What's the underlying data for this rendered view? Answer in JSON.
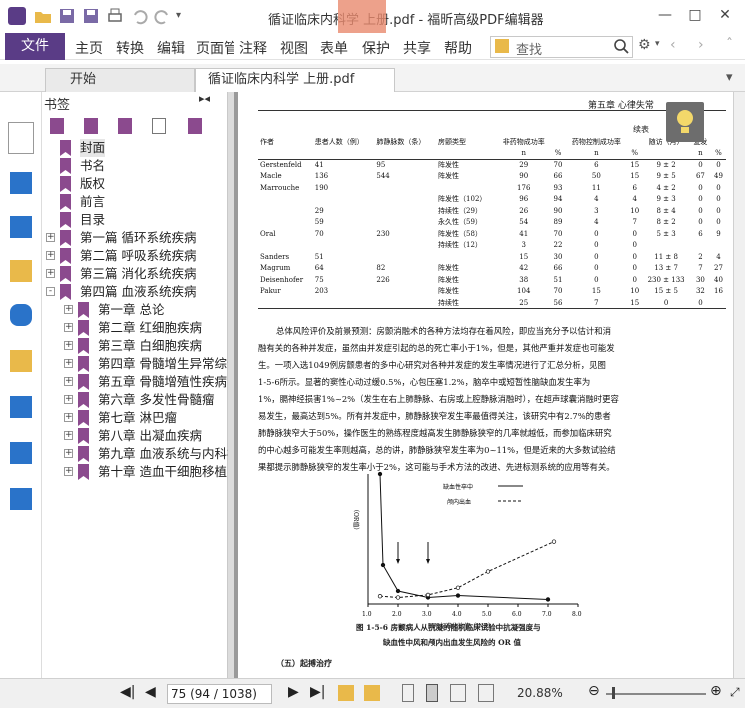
{
  "title": "循证临床内科学 上册.pdf - 福昕高级PDF编辑器",
  "menu": {
    "file": "文件",
    "items": [
      "主页",
      "转换",
      "编辑",
      "页面管理",
      "注释",
      "视图",
      "表单",
      "保护",
      "共享",
      "帮助"
    ]
  },
  "search": {
    "placeholder": "查找"
  },
  "tabs": [
    {
      "label": "开始"
    },
    {
      "label": "循证临床内科学 上册.pdf"
    }
  ],
  "bookmarks": {
    "header": "书签",
    "items": [
      {
        "label": "封面",
        "level": 0,
        "expander": ""
      },
      {
        "label": "书名",
        "level": 0,
        "expander": ""
      },
      {
        "label": "版权",
        "level": 0,
        "expander": ""
      },
      {
        "label": "前言",
        "level": 0,
        "expander": ""
      },
      {
        "label": "目录",
        "level": 0,
        "expander": ""
      },
      {
        "label": "第一篇 循环系统疾病",
        "level": 0,
        "expander": "+"
      },
      {
        "label": "第二篇 呼吸系统疾病",
        "level": 0,
        "expander": "+"
      },
      {
        "label": "第三篇 消化系统疾病",
        "level": 0,
        "expander": "+"
      },
      {
        "label": "第四篇 血液系统疾病",
        "level": 0,
        "expander": "-"
      },
      {
        "label": "第一章 总论",
        "level": 1,
        "expander": "+"
      },
      {
        "label": "第二章 红细胞疾病",
        "level": 1,
        "expander": "+"
      },
      {
        "label": "第三章 白细胞疾病",
        "level": 1,
        "expander": "+"
      },
      {
        "label": "第四章 骨髓增生异常综合征",
        "level": 1,
        "expander": "+"
      },
      {
        "label": "第五章 骨髓增殖性疾病",
        "level": 1,
        "expander": "+"
      },
      {
        "label": "第六章 多发性骨髓瘤",
        "level": 1,
        "expander": "+"
      },
      {
        "label": "第七章 淋巴瘤",
        "level": 1,
        "expander": "+"
      },
      {
        "label": "第八章 出凝血疾病",
        "level": 1,
        "expander": "+"
      },
      {
        "label": "第九章 血液系统与内科疾病",
        "level": 1,
        "expander": "+"
      },
      {
        "label": "第十章 造血干细胞移植",
        "level": 1,
        "expander": "+"
      }
    ]
  },
  "page": {
    "running_head": "第五章 心律失常",
    "table_cont": "续表",
    "headers": [
      "作者",
      "患者人数（例）",
      "肺静脉数（条）",
      "房颤类型",
      "非药物成功率",
      "",
      "药物控制成功率",
      "",
      "随访（月）",
      "复发",
      ""
    ],
    "subheaders": [
      "",
      "",
      "",
      "",
      "n",
      "%",
      "n",
      "%",
      "",
      "n",
      "%"
    ],
    "rows": [
      [
        "Gerstenfeld",
        "41",
        "95",
        "阵发性",
        "29",
        "70",
        "6",
        "15",
        "9 ± 2",
        "0",
        "0"
      ],
      [
        "Macle",
        "136",
        "544",
        "阵发性",
        "90",
        "66",
        "50",
        "15",
        "9 ± 5",
        "67",
        "49"
      ],
      [
        "Marrouche",
        "190",
        "",
        "",
        "176",
        "93",
        "11",
        "6",
        "4 ± 2",
        "0",
        "0"
      ],
      [
        "",
        "",
        "",
        "阵发性（102）",
        "96",
        "94",
        "4",
        "4",
        "9 ± 3",
        "0",
        "0"
      ],
      [
        "",
        "29",
        "",
        "持续性（29）",
        "26",
        "90",
        "3",
        "10",
        "8 ± 4",
        "0",
        "0"
      ],
      [
        "",
        "59",
        "",
        "永久性（59）",
        "54",
        "89",
        "4",
        "7",
        "8 ± 2",
        "0",
        "0"
      ],
      [
        "Oral",
        "70",
        "230",
        "阵发性（58）",
        "41",
        "70",
        "0",
        "0",
        "5 ± 3",
        "6",
        "9"
      ],
      [
        "",
        "",
        "",
        "持续性（12）",
        "3",
        "22",
        "0",
        "0",
        "",
        "",
        ""
      ],
      [
        "Sanders",
        "51",
        "",
        "",
        "15",
        "30",
        "0",
        "0",
        "11 ± 8",
        "2",
        "4"
      ],
      [
        "Magrum",
        "64",
        "82",
        "阵发性",
        "42",
        "66",
        "0",
        "0",
        "13 ± 7",
        "7",
        "27"
      ],
      [
        "Deisenhofer",
        "75",
        "226",
        "阵发性",
        "38",
        "51",
        "0",
        "0",
        "230 ± 133",
        "30",
        "40"
      ],
      [
        "Pakur",
        "203",
        "",
        "阵发性",
        "104",
        "70",
        "15",
        "10",
        "15 ± 5",
        "32",
        "16"
      ],
      [
        "",
        "",
        "",
        "持续性",
        "25",
        "56",
        "7",
        "15",
        "0",
        "0",
        ""
      ]
    ],
    "paragraph": [
      "总体风险评价及前景预测：房颤消融术的各种方法均存在着风险，即应当充分予以估计和消",
      "融有关的各种并发症，虽然由并发症引起的总的死亡率小于1%，但是，其他严重并发症也可能发",
      "生。一项入选1049例房颤患者的多中心研究对各种并发症的发生率情况进行了汇总分析，见图",
      "1-5-6所示。显著的窦性心动过缓0.5%，心包压塞1.2%，脑卒中或短暂性脑缺血发生率为",
      "1%，膈神经损害1%~2%（发生在右上肺静脉、右房或上腔静脉消融时），在超声球囊消融时更容",
      "易发生，最高达到5%。所有并发症中，肺静脉狭窄发生率最值得关注，该研究中有2.7%的患者",
      "肺静脉狭窄大于50%，操作医生的熟练程度越高发生肺静脉狭窄的几率就越低，而参加临床研究",
      "的中心越多可能发生率则越高，总的讲，肺静脉狭窄发生率为0~11%，但是近来的大多数试验结",
      "果都提示肺静脉狭窄的发生率小于2%，这可能与手术方法的改进、先进标测系统的应用等有关。"
    ],
    "figure_caption_1": "图 1-5-6  房颤病人从抗凝的随机临床试验中抗凝强度与",
    "figure_caption_2": "缺血性中风和颅内出血发生风险的 OR 值",
    "section": "（五）起搏治疗",
    "legend_1": "缺血性卒中",
    "legend_2": "颅内出血",
    "ylabel": "（OR值）",
    "xlabel": "国际标准化比值（INR）"
  },
  "chart_data": {
    "type": "line",
    "xlabel": "国际标准化比值（INR）",
    "ylabel": "（OR值）",
    "xlim": [
      1.0,
      8.0
    ],
    "ylim": [
      0,
      20
    ],
    "xticks": [
      "1.0",
      "2.0",
      "3.0",
      "4.0",
      "5.0",
      "6.0",
      "7.0",
      "8.0"
    ],
    "yticks": [
      "20",
      "15",
      "10",
      "5"
    ],
    "series": [
      {
        "name": "缺血性卒中",
        "style": "solid",
        "points": [
          [
            1.4,
            20
          ],
          [
            1.5,
            6
          ],
          [
            2.0,
            2
          ],
          [
            3.0,
            1
          ],
          [
            4.0,
            1.3
          ],
          [
            7.0,
            0.7
          ]
        ]
      },
      {
        "name": "颅内出血",
        "style": "dashed",
        "points": [
          [
            1.4,
            1.2
          ],
          [
            2.0,
            1
          ],
          [
            3.0,
            1.4
          ],
          [
            4.0,
            2.5
          ],
          [
            5.0,
            5
          ],
          [
            7.2,
            9.6
          ]
        ]
      }
    ]
  },
  "status": {
    "page_input": "75 (94 / 1038)",
    "zoom": "20.88%"
  }
}
